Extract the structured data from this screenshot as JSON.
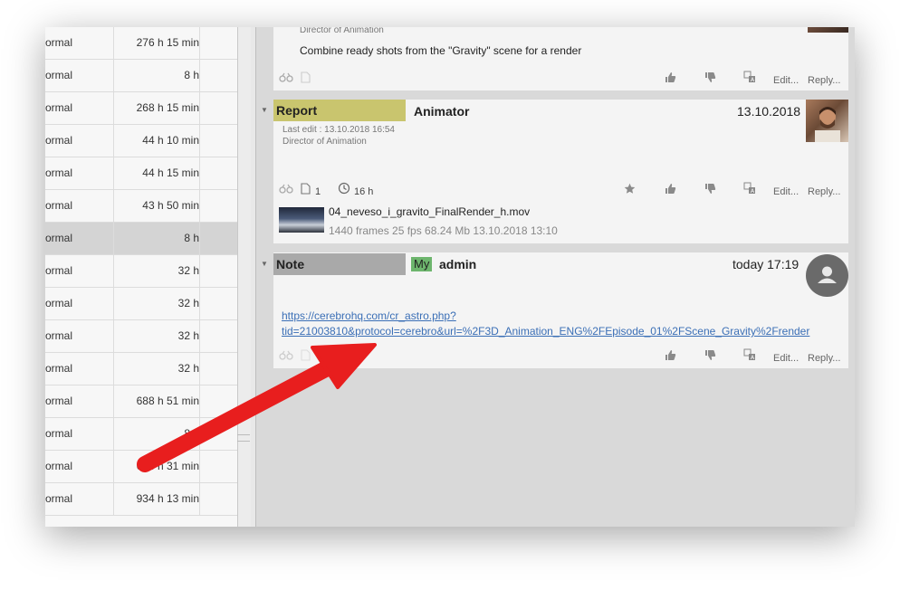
{
  "table": {
    "rows": [
      {
        "status": "ormal",
        "time": "276 h 15 min"
      },
      {
        "status": "ormal",
        "time": "8 h"
      },
      {
        "status": "ormal",
        "time": "268 h 15 min"
      },
      {
        "status": "ormal",
        "time": "44 h 10 min"
      },
      {
        "status": "ormal",
        "time": "44 h 15 min"
      },
      {
        "status": "ormal",
        "time": "43 h 50 min"
      },
      {
        "status": "ormal",
        "time": "8 h"
      },
      {
        "status": "ormal",
        "time": "32 h"
      },
      {
        "status": "ormal",
        "time": "32 h"
      },
      {
        "status": "ormal",
        "time": "32 h"
      },
      {
        "status": "ormal",
        "time": "32 h"
      },
      {
        "status": "ormal",
        "time": "688 h 51 min"
      },
      {
        "status": "ormal",
        "time": "8 h"
      },
      {
        "status": "ormal",
        "time": "688 h 31 min"
      },
      {
        "status": "ormal",
        "time": "934 h 13 min"
      }
    ],
    "selected_index": 6
  },
  "top_card": {
    "role": "Director of Animation",
    "message": "Combine ready shots from the \"Gravity\" scene for a render",
    "edit_label": "Edit...",
    "reply_label": "Reply..."
  },
  "report_card": {
    "type": "Report",
    "type_color": "#c9c56e",
    "author": "Animator",
    "date": "13.10.2018",
    "last_edit": "Last edit : 13.10.2018 16:54",
    "role": "Director of Animation",
    "attachments_count": "1",
    "time_spent": "16 h",
    "file_name": "04_neveso_i_gravito_FinalRender_h.mov",
    "file_info": "1440 frames 25 fps 68.24 Mb 13.10.2018 13:10",
    "edit_label": "Edit...",
    "reply_label": "Reply..."
  },
  "note_card": {
    "type": "Note",
    "type_color": "#a9a9a9",
    "badge": "My",
    "badge_color": "#6db56d",
    "author": "admin",
    "date": "today 17:19",
    "link_line1": "https://cerebrohq.com/cr_astro.php?",
    "link_line2": "tid=21003810&protocol=cerebro&url=%2F3D_Animation_ENG%2FEpisode_01%2FScene_Gravity%2Frender",
    "edit_label": "Edit...",
    "reply_label": "Reply..."
  },
  "icons": {
    "spectacles": "spectacles-icon",
    "document": "document-icon",
    "clock": "clock-icon",
    "star": "star-icon",
    "thumbs_up": "thumbs-up-icon",
    "thumbs_down": "thumbs-down-icon",
    "translate": "translate-icon",
    "avatar": "avatar-icon",
    "arrow": "red-arrow-annotation"
  },
  "colors": {
    "accent_arrow": "#e81e1e",
    "link": "#3b6fb6"
  }
}
